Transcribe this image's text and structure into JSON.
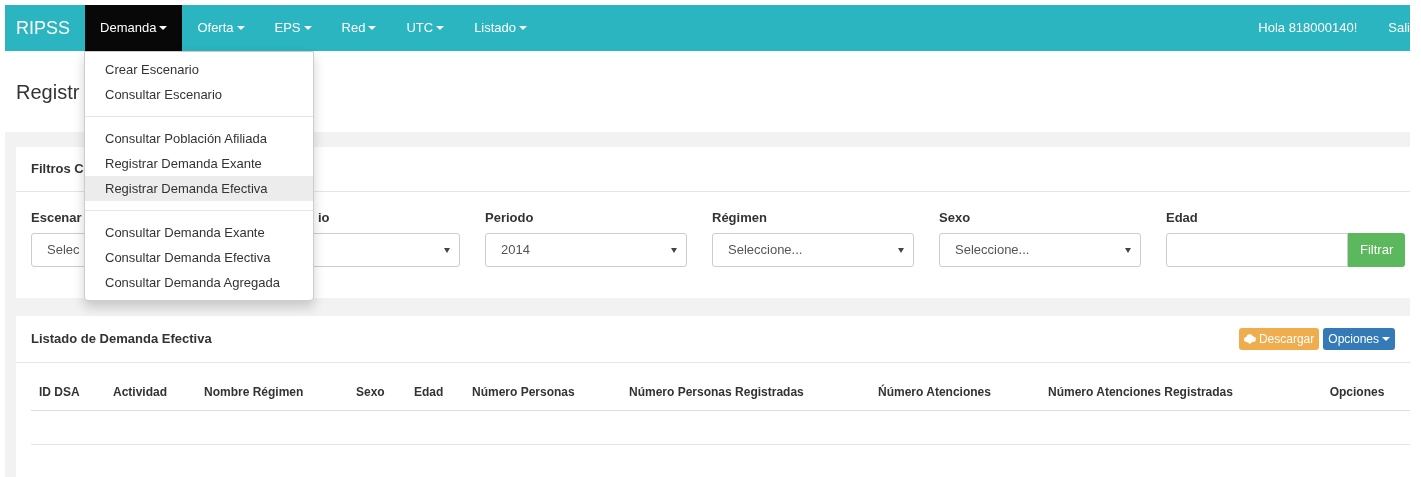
{
  "navbar": {
    "brand": "RIPSS",
    "menus": [
      {
        "label": "Demanda",
        "selected": true
      },
      {
        "label": "Oferta",
        "selected": false
      },
      {
        "label": "EPS",
        "selected": false
      },
      {
        "label": "Red",
        "selected": false
      },
      {
        "label": "UTC",
        "selected": false
      },
      {
        "label": "Listado",
        "selected": false
      }
    ],
    "greeting": "Hola 818000140!",
    "logout": "Sali"
  },
  "dropdown": {
    "groups": [
      [
        {
          "label": "Crear Escenario",
          "selected": false
        },
        {
          "label": "Consultar Escenario",
          "selected": false
        }
      ],
      [
        {
          "label": "Consultar Población Afiliada",
          "selected": false
        },
        {
          "label": "Registrar Demanda Exante",
          "selected": false
        },
        {
          "label": "Registrar Demanda Efectiva",
          "selected": true
        }
      ],
      [
        {
          "label": "Consultar Demanda Exante",
          "selected": false
        },
        {
          "label": "Consultar Demanda Efectiva",
          "selected": false
        },
        {
          "label": "Consultar Demanda Agregada",
          "selected": false
        }
      ]
    ]
  },
  "page_title": "Registr",
  "filters_panel": {
    "title": "Filtros C",
    "filters": [
      {
        "label": "Escenar",
        "kind": "select",
        "value": "Selec"
      },
      {
        "label": "io",
        "kind": "select"
      },
      {
        "label": "Periodo",
        "kind": "select",
        "value": "2014"
      },
      {
        "label": "Régimen",
        "kind": "select",
        "value": "Seleccione..."
      },
      {
        "label": "Sexo",
        "kind": "select",
        "value": "Seleccione..."
      },
      {
        "label": "Edad",
        "kind": "input",
        "button": "Filtrar"
      }
    ]
  },
  "list_panel": {
    "title": "Listado de Demanda Efectiva",
    "buttons": [
      {
        "label": "Descargar",
        "kind": "download"
      },
      {
        "label": "Opciones",
        "kind": "options"
      }
    ],
    "table": {
      "columns": [
        "ID DSA",
        "Actividad",
        "Nombre Régimen",
        "Sexo",
        "Edad",
        "Número Personas",
        "Número Personas Registradas",
        "Ńúmero Atenciones",
        "Número Atenciones Registradas",
        "Opciones"
      ]
    }
  }
}
